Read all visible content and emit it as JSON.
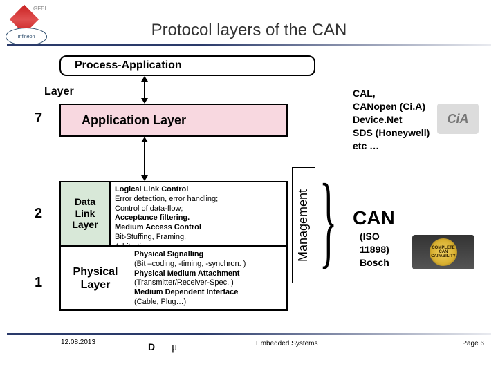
{
  "logo": {
    "text": "Infineon",
    "tag": "GFEI"
  },
  "title": "Protocol layers of the CAN",
  "proc_app": "Process-Application",
  "layer_heading": "Layer",
  "numbers": {
    "seven": "7",
    "two": "2",
    "one": "1"
  },
  "app_layer": "Application Layer",
  "data_link": {
    "left": "Data\nLink\nLayer",
    "llc_head": "Logical Link Control",
    "llc1": "Error detection, error handling;",
    "llc2": "Control of data-flow;",
    "llc3": "Acceptance filtering.",
    "mac_head": "Medium Access Control",
    "mac1": "Bit-Stuffing, Framing,",
    "mac2": "Arbitration"
  },
  "phys": {
    "left": "Physical\nLayer",
    "p1_head": "Physical Signalling",
    "p1": "(Bit –coding, -timing, -synchron. )",
    "p2_head": "Physical Medium Attachment",
    "p2": "(Transmitter/Receiver-Spec. )",
    "p3_head": "Medium Dependent Interface",
    "p3": "(Cable, Plug…)"
  },
  "management": "Management",
  "examples": {
    "l1": "CAL,",
    "l2": "CANopen (Ci.A)",
    "l3": "Device.Net",
    "l4": "SDS (Honeywell)",
    "l5": "etc …"
  },
  "cia_logo": "CiA",
  "can": "CAN",
  "can_sub": {
    "l1": "(ISO",
    "l2": "11898)",
    "l3": "Bosch"
  },
  "ccc_logo": "COMPLETE CAN CAPABILITY",
  "footer": {
    "date": "12.08.2013",
    "d": "D",
    "mu": "μ",
    "mid": "Embedded Systems",
    "page": "Page 6"
  }
}
